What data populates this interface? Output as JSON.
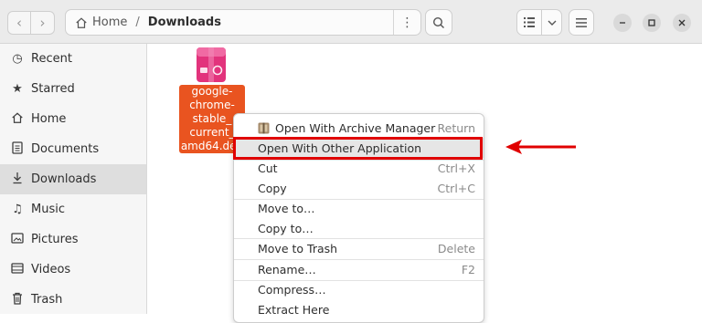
{
  "header": {
    "path_home": "Home",
    "path_separator": "/",
    "path_current": "Downloads"
  },
  "sidebar": {
    "items": [
      {
        "label": "Recent",
        "icon": "clock-icon"
      },
      {
        "label": "Starred",
        "icon": "star-icon"
      },
      {
        "label": "Home",
        "icon": "home-icon"
      },
      {
        "label": "Documents",
        "icon": "document-icon"
      },
      {
        "label": "Downloads",
        "icon": "download-icon",
        "active": true
      },
      {
        "label": "Music",
        "icon": "music-icon"
      },
      {
        "label": "Pictures",
        "icon": "picture-icon"
      },
      {
        "label": "Videos",
        "icon": "video-icon"
      },
      {
        "label": "Trash",
        "icon": "trash-icon"
      }
    ]
  },
  "file": {
    "name_lines": [
      "google-",
      "chrome-",
      "stable_",
      "current_",
      "amd64.deb"
    ],
    "icon": "deb-package-icon",
    "selection_color": "#e95420"
  },
  "context_menu": {
    "items": [
      {
        "label": "Open With Archive Manager",
        "accel": "Return"
      },
      {
        "label": "Open With Other Application",
        "accel": ""
      },
      {
        "label": "Cut",
        "accel": "Ctrl+X"
      },
      {
        "label": "Copy",
        "accel": "Ctrl+C"
      },
      {
        "label": "Move to…",
        "accel": ""
      },
      {
        "label": "Copy to…",
        "accel": ""
      },
      {
        "label": "Move to Trash",
        "accel": "Delete"
      },
      {
        "label": "Rename…",
        "accel": "F2"
      },
      {
        "label": "Compress…",
        "accel": ""
      },
      {
        "label": "Extract Here",
        "accel": ""
      }
    ]
  },
  "annotation": {
    "highlight_color": "#e00000"
  }
}
